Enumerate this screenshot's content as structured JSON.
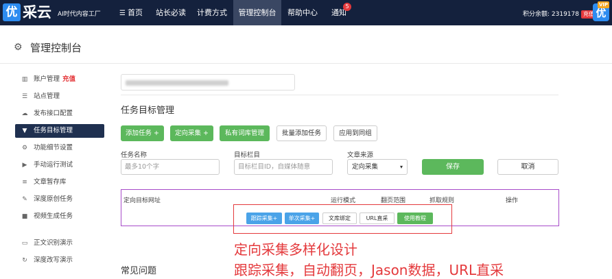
{
  "brand": {
    "logo_char": "优",
    "name": "采云",
    "slogan": "AI时代内容工厂"
  },
  "nav": {
    "items": [
      {
        "label": "首页",
        "icon": "menu-icon"
      },
      {
        "label": "站长必读"
      },
      {
        "label": "计费方式"
      },
      {
        "label": "管理控制台",
        "active": true
      },
      {
        "label": "帮助中心"
      },
      {
        "label": "通知",
        "badge": "5"
      }
    ]
  },
  "account": {
    "points": "积分余额: 2319178",
    "recharge": "充值",
    "avatar_char": "优",
    "vip": "VIP"
  },
  "page": {
    "title": "管理控制台"
  },
  "sidebar": {
    "items": [
      {
        "label": "账户管理",
        "icon": "chart-icon",
        "extra": "充值"
      },
      {
        "label": "站点管理",
        "icon": "server-icon"
      },
      {
        "label": "发布接口配置",
        "icon": "cloud-upload-icon"
      },
      {
        "label": "任务目标管理",
        "icon": "filter-icon",
        "active": true
      },
      {
        "label": "功能细节设置",
        "icon": "gears-icon"
      },
      {
        "label": "手动运行测试",
        "icon": "play-circle-icon"
      },
      {
        "label": "文章暂存库",
        "icon": "database-icon"
      },
      {
        "label": "深度原创任务",
        "icon": "edit-icon"
      },
      {
        "label": "视频生成任务",
        "icon": "video-icon"
      },
      {
        "label": "正文识别演示",
        "icon": "monitor-icon"
      },
      {
        "label": "深度改写演示",
        "icon": "refresh-icon"
      }
    ]
  },
  "main": {
    "section_title": "任务目标管理",
    "buttons": {
      "add_task": "添加任务 +",
      "directed_collect": "定向采集 +",
      "private_lexicon": "私有词库管理",
      "batch_add": "批量添加任务",
      "apply_group": "应用到同组"
    },
    "form": {
      "task_name_label": "任务名称",
      "task_name_placeholder": "最多10个字",
      "target_column_label": "目标栏目",
      "target_column_placeholder": "目标栏目ID，自媒体随意",
      "source_label": "文章来源",
      "source_value": "定向采集",
      "save": "保存",
      "cancel": "取消"
    },
    "table": {
      "headers": [
        "定向目标网址",
        "运行模式",
        "翻页范围",
        "抓取规则",
        "操作"
      ],
      "row_buttons": [
        "跟踪采集+",
        "单次采集+",
        "文库绑定",
        "URL直采",
        "使用教程"
      ]
    },
    "annotation": {
      "line1": "定向采集多样化设计",
      "line2": "跟踪采集，自动翻页，Jason数据，URL直采"
    },
    "faq_title": "常见问题"
  },
  "colors": {
    "topbar": "#14213d",
    "accent_green": "#5cb85c",
    "annotation_red": "#e4393c",
    "table_border": "#a64ac9"
  }
}
